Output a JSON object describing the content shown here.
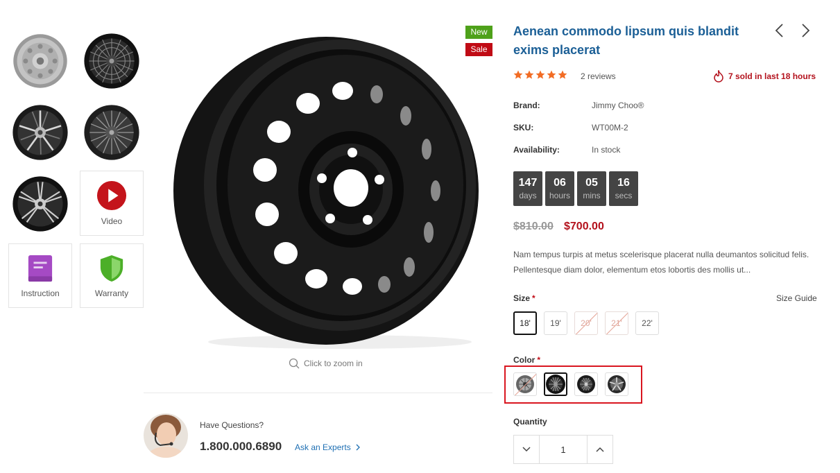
{
  "gallery": {
    "video_label": "Video",
    "instruction_label": "Instruction",
    "warranty_label": "Warranty",
    "zoom_hint": "Click to zoom in"
  },
  "badges": {
    "new": "New",
    "sale": "Sale"
  },
  "product": {
    "title": "Aenean commodo lipsum quis blandit exims placerat",
    "rating": 5,
    "reviews": "2 reviews",
    "sold_text": "7 sold in last 18 hours",
    "meta": [
      {
        "key": "Brand:",
        "value": "Jimmy Choo®"
      },
      {
        "key": "SKU:",
        "value": "WT00M-2"
      },
      {
        "key": "Availability:",
        "value": "In stock"
      }
    ],
    "countdown": [
      {
        "num": "147",
        "unit": "days"
      },
      {
        "num": "06",
        "unit": "hours"
      },
      {
        "num": "05",
        "unit": "mins"
      },
      {
        "num": "16",
        "unit": "secs"
      }
    ],
    "price_old": "$810.00",
    "price_new": "$700.00",
    "description": "Nam tempus turpis at metus scelerisque placerat nulla deumantos solicitud felis. Pellentesque diam dolor, elementum etos lobortis des mollis ut...",
    "size_label": "Size",
    "size_guide": "Size Guide",
    "sizes": [
      {
        "label": "18'",
        "state": "active"
      },
      {
        "label": "19'",
        "state": "normal"
      },
      {
        "label": "20'",
        "state": "out"
      },
      {
        "label": "21'",
        "state": "out"
      },
      {
        "label": "22'",
        "state": "normal"
      }
    ],
    "color_label": "Color",
    "colors": [
      "silver-mesh",
      "black-mesh",
      "dark-spoke",
      "gunmetal-spoke"
    ],
    "quantity_label": "Quantity",
    "quantity": "1"
  },
  "support": {
    "question": "Have Questions?",
    "phone": "1.800.000.6890",
    "ask": "Ask an Experts"
  },
  "colors": {
    "title": "#1b5f96",
    "sale_red": "#b3111c",
    "new_green": "#4ea11a",
    "star": "#f26c24",
    "highlight": "#d9151f"
  }
}
